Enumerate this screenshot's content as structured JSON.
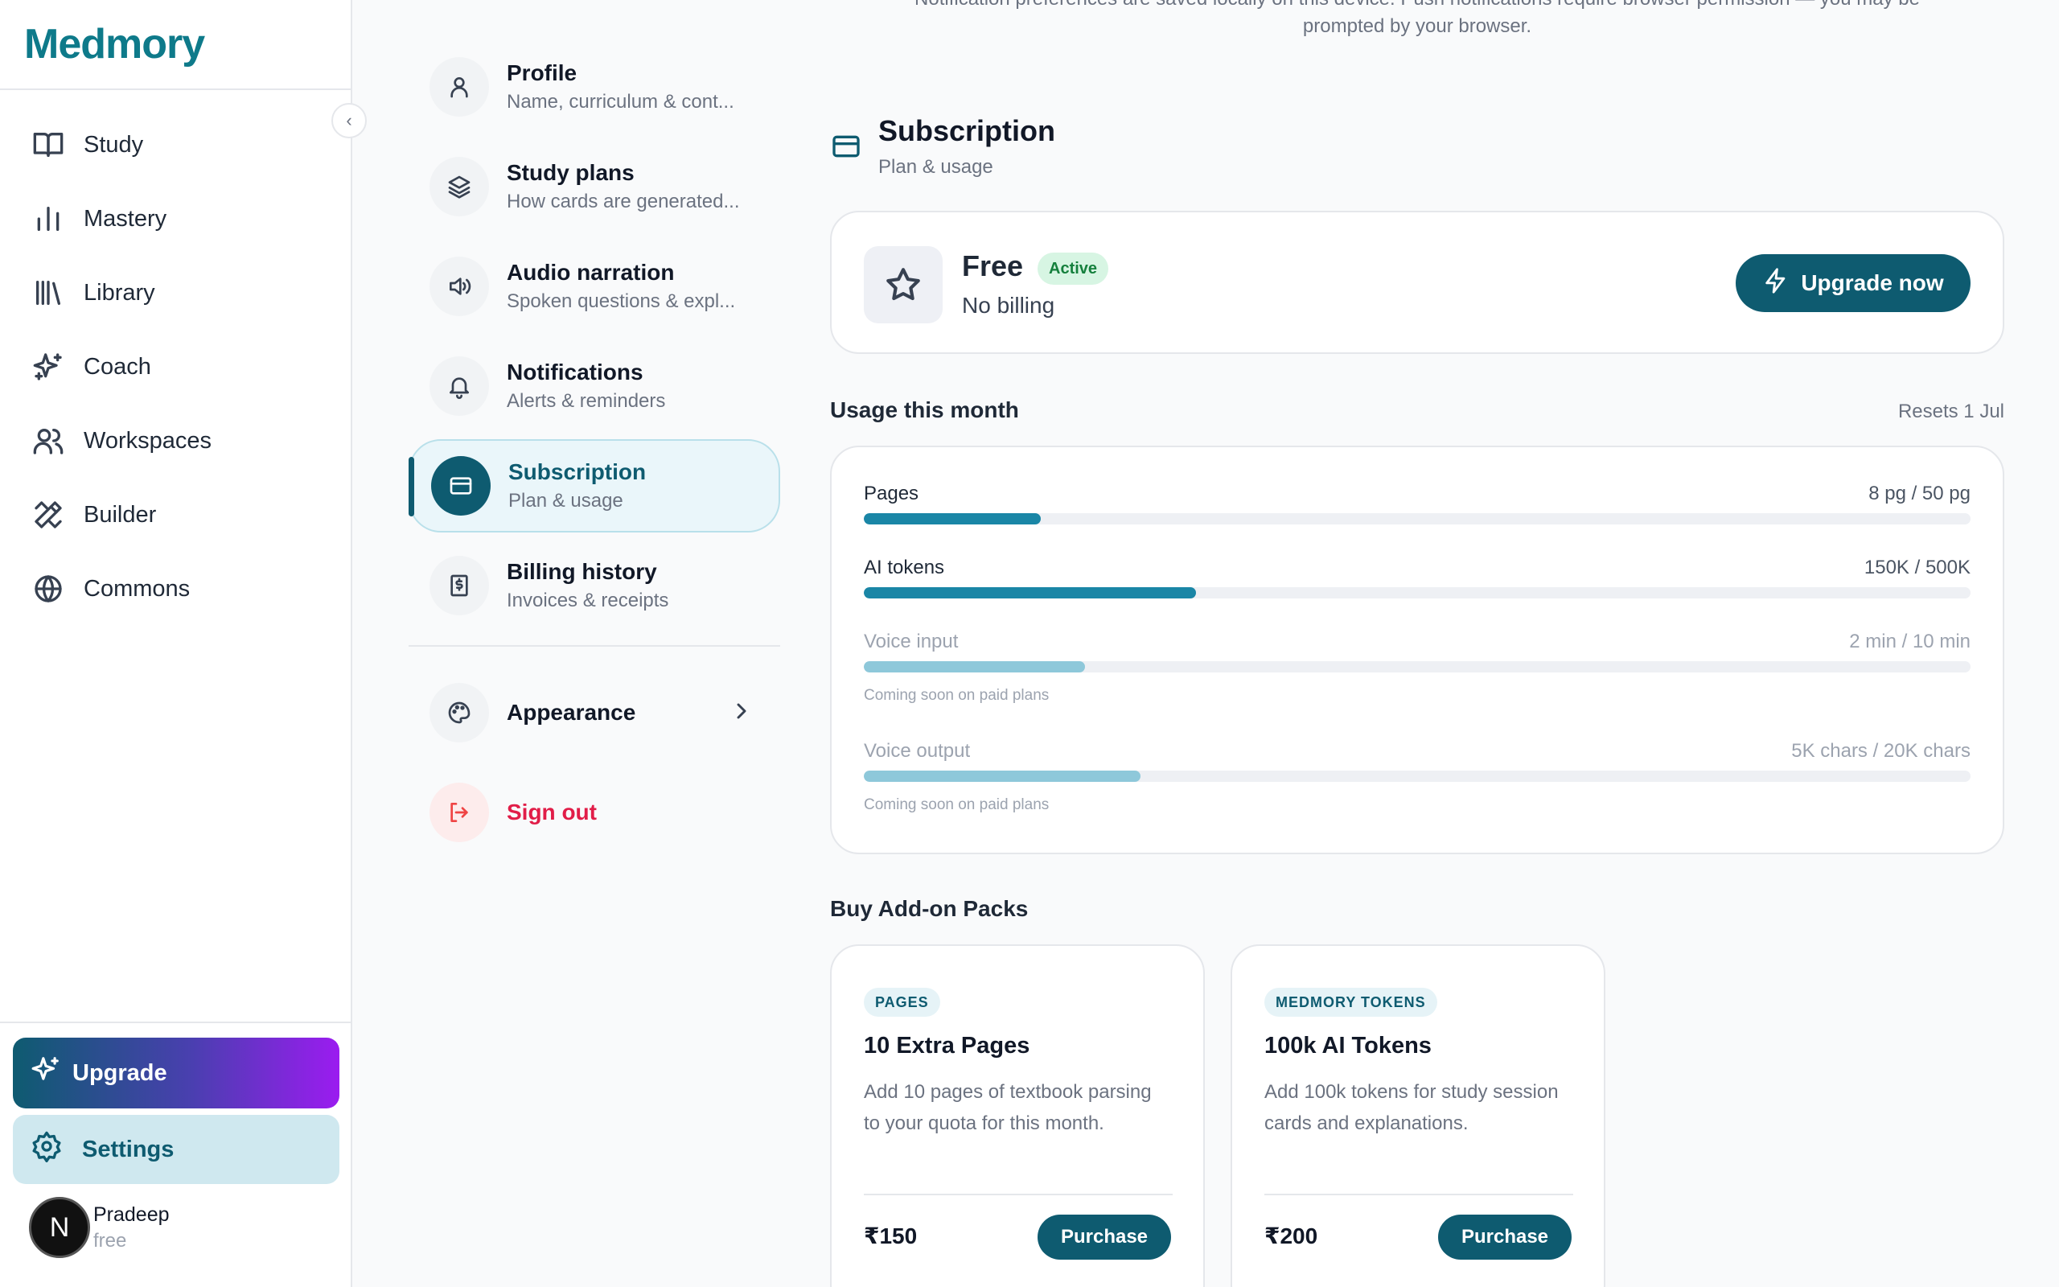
{
  "app": {
    "logo": "Medmory"
  },
  "sidebar": {
    "items": [
      {
        "label": "Study",
        "icon": "book-open-icon"
      },
      {
        "label": "Mastery",
        "icon": "bar-chart-icon"
      },
      {
        "label": "Library",
        "icon": "library-icon"
      },
      {
        "label": "Coach",
        "icon": "sparkles-icon"
      },
      {
        "label": "Workspaces",
        "icon": "users-icon"
      },
      {
        "label": "Builder",
        "icon": "pencil-ruler-icon"
      },
      {
        "label": "Commons",
        "icon": "globe-icon"
      }
    ],
    "upgrade_label": "Upgrade",
    "settings_label": "Settings",
    "user": {
      "initial": "N",
      "name": "Pradeep",
      "plan": "free"
    }
  },
  "settings_menu": {
    "items": [
      {
        "title": "Profile",
        "subtitle": "Name, curriculum & cont...",
        "icon": "user-icon"
      },
      {
        "title": "Study plans",
        "subtitle": "How cards are generated...",
        "icon": "layers-icon"
      },
      {
        "title": "Audio narration",
        "subtitle": "Spoken questions & expl...",
        "icon": "speaker-icon"
      },
      {
        "title": "Notifications",
        "subtitle": "Alerts & reminders",
        "icon": "bell-icon"
      },
      {
        "title": "Subscription",
        "subtitle": "Plan & usage",
        "icon": "credit-card-icon",
        "active": true
      },
      {
        "title": "Billing history",
        "subtitle": "Invoices & receipts",
        "icon": "receipt-icon"
      }
    ],
    "appearance_label": "Appearance",
    "signout_label": "Sign out"
  },
  "notice": {
    "line1": "Notification preferences are saved locally on this device. Push notifications require browser permission — you may be",
    "line2": "prompted by your browser."
  },
  "subscription": {
    "title": "Subscription",
    "subtitle": "Plan & usage",
    "plan_name": "Free",
    "plan_status": "Active",
    "plan_billing": "No billing",
    "upgrade_button": "Upgrade now"
  },
  "usage": {
    "title": "Usage this month",
    "reset": "Resets 1 Jul",
    "rows": [
      {
        "label": "Pages",
        "value": "8 pg / 50 pg",
        "fraction": 0.16,
        "note": ""
      },
      {
        "label": "AI tokens",
        "value": "150K / 500K",
        "fraction": 0.3,
        "note": ""
      },
      {
        "label": "Voice input",
        "value": "2 min / 10 min",
        "fraction": 0.2,
        "note": "Coming soon on paid plans"
      },
      {
        "label": "Voice output",
        "value": "5K chars / 20K chars",
        "fraction": 0.25,
        "note": "Coming soon on paid plans"
      }
    ]
  },
  "addons": {
    "title": "Buy Add-on Packs",
    "packs": [
      {
        "tag": "PAGES",
        "title": "10 Extra Pages",
        "description": "Add 10 pages of textbook parsing to your quota for this month.",
        "price": "₹150",
        "button": "Purchase"
      },
      {
        "tag": "MEDMORY TOKENS",
        "title": "100k AI Tokens",
        "description": "Add 100k tokens for study session cards and explanations.",
        "price": "₹200",
        "button": "Purchase"
      }
    ]
  },
  "colors": {
    "brand": "#0e5b70",
    "accent": "#1a86a6",
    "active_badge": "#15803d",
    "danger": "#e11d48"
  }
}
